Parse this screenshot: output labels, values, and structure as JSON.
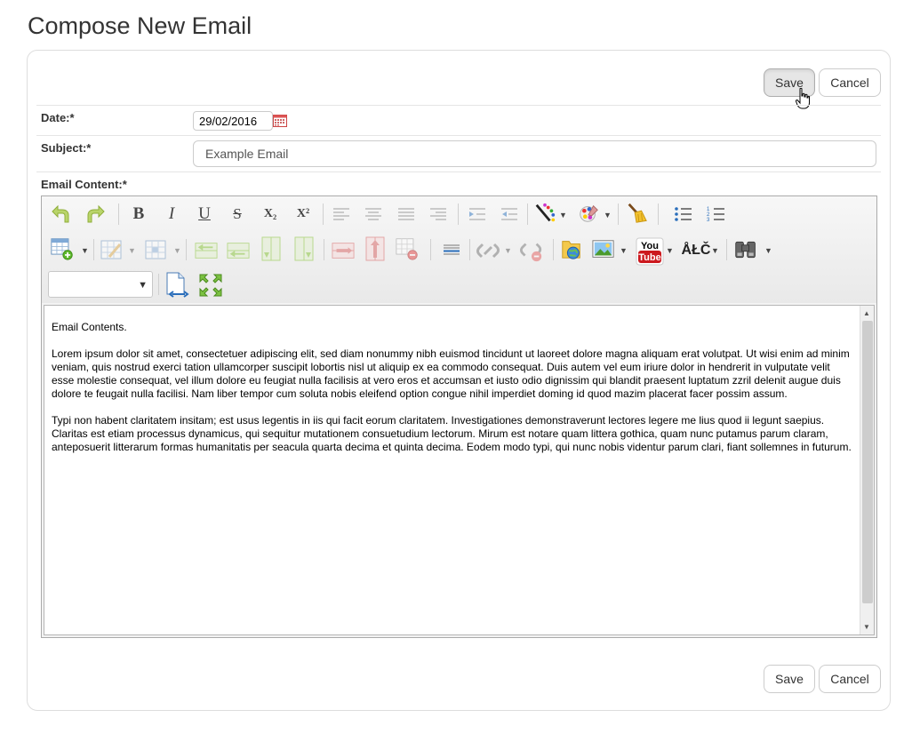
{
  "page": {
    "title": "Compose New Email"
  },
  "actions": {
    "save_label": "Save",
    "cancel_label": "Cancel"
  },
  "form": {
    "date_label": "Date:*",
    "date_value": "29/02/2016",
    "subject_label": "Subject:*",
    "subject_value": "Example Email",
    "content_label": "Email Content:*"
  },
  "editor": {
    "font_select_value": "",
    "toolbar_icons": [
      "undo-icon",
      "redo-icon",
      "bold-icon",
      "italic-icon",
      "underline-icon",
      "strikethrough-icon",
      "subscript-icon",
      "superscript-icon",
      "align-left-icon",
      "align-center-icon",
      "align-justify-icon",
      "align-right-icon",
      "indent-icon",
      "outdent-icon",
      "text-color-icon",
      "background-color-icon",
      "clear-format-icon",
      "bullet-list-icon",
      "numbered-list-icon",
      "insert-table-icon",
      "table-properties-icon",
      "cell-properties-icon",
      "insert-row-before-icon",
      "insert-row-after-icon",
      "insert-column-before-icon",
      "insert-column-after-icon",
      "delete-row-icon",
      "delete-column-icon",
      "delete-table-icon",
      "horizontal-rule-icon",
      "link-icon",
      "unlink-icon",
      "file-manager-icon",
      "image-icon",
      "youtube-icon",
      "special-characters-icon",
      "find-replace-icon",
      "html-source-icon",
      "fullscreen-icon"
    ],
    "glyphs": {
      "bold": "B",
      "italic": "I",
      "underline": "U",
      "strike": "S",
      "subscript": "X₂",
      "superscript": "X²",
      "youtube_top": "You",
      "youtube_bottom": "Tube",
      "special_chars": "ÅŁČ"
    },
    "content": {
      "greeting": "Email Contents.",
      "paragraph1": "Lorem ipsum dolor sit amet, consectetuer adipiscing elit, sed diam nonummy nibh euismod tincidunt ut laoreet dolore magna aliquam erat volutpat. Ut wisi enim ad minim veniam, quis nostrud exerci tation ullamcorper suscipit lobortis nisl ut aliquip ex ea commodo consequat. Duis autem vel eum iriure dolor in hendrerit in vulputate velit esse molestie consequat, vel illum dolore eu feugiat nulla facilisis at vero eros et accumsan et iusto odio dignissim qui blandit praesent luptatum zzril delenit augue duis dolore te feugait nulla facilisi. Nam liber tempor cum soluta nobis eleifend option congue nihil imperdiet doming id quod mazim placerat facer possim assum.",
      "paragraph2": "Typi non habent claritatem insitam; est usus legentis in iis qui facit eorum claritatem. Investigationes demonstraverunt lectores legere me lius quod ii legunt saepius. Claritas est etiam processus dynamicus, qui sequitur mutationem consuetudium lectorum. Mirum est notare quam littera gothica, quam nunc putamus parum claram, anteposuerit litterarum formas humanitatis per seacula quarta decima et quinta decima. Eodem modo typi, qui nunc nobis videntur parum clari, fiant sollemnes in futurum."
    }
  },
  "colors": {
    "accent_green": "#8cc63f",
    "accent_red": "#cc3333",
    "youtube_red": "#cc181e",
    "link_blue": "#2a6ebb"
  }
}
